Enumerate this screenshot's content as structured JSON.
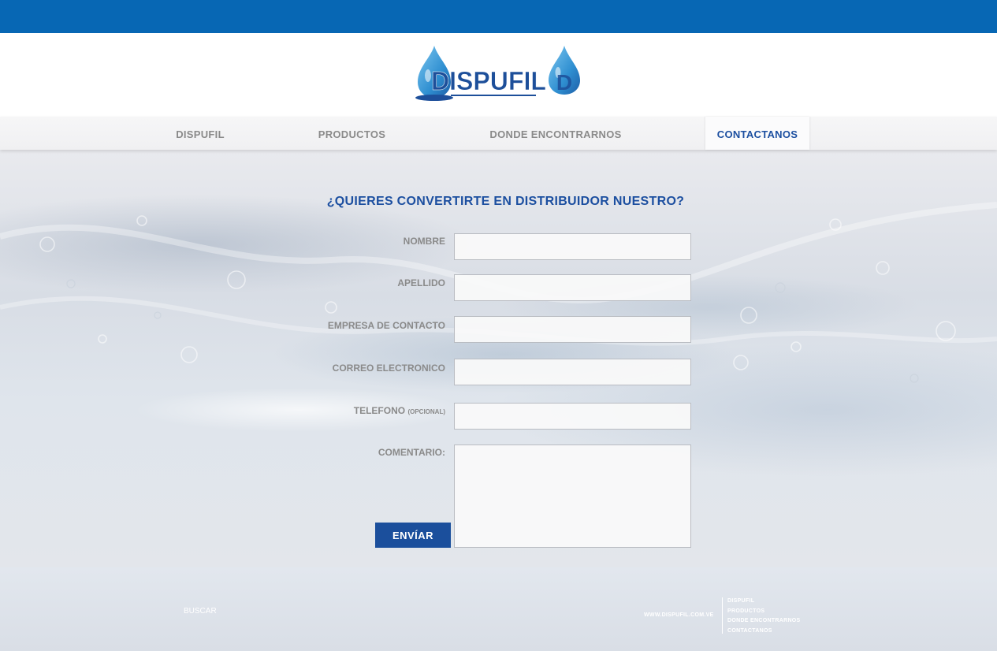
{
  "colors": {
    "top_bar": "#0767b4",
    "brand_blue": "#1c4fa0",
    "nav_text": "#8a8a8a",
    "button": "#1b4f9c"
  },
  "header": {
    "logo_text": "DISPUFIL"
  },
  "nav": {
    "items": [
      {
        "label": "DISPUFIL"
      },
      {
        "label": "PRODUCTOS"
      },
      {
        "label": "DONDE ENCONTRARNOS"
      },
      {
        "label": "CONTACTANOS",
        "active": true
      }
    ]
  },
  "form": {
    "title": "¿QUIERES CONVERTIRTE EN DISTRIBUIDOR NUESTRO?",
    "fields": {
      "nombre": {
        "label": "NOMBRE",
        "value": ""
      },
      "apellido": {
        "label": "APELLIDO",
        "value": ""
      },
      "empresa": {
        "label": "EMPRESA DE CONTACTO",
        "value": ""
      },
      "correo": {
        "label": "CORREO ELECTRONICO",
        "value": ""
      },
      "telefono": {
        "label": "TELEFONO",
        "note": "(OPCIONAL)",
        "value": ""
      },
      "comentario": {
        "label": "COMENTARIO:",
        "value": ""
      }
    },
    "submit_label": "ENVÍAR"
  },
  "footer": {
    "search_label": "BUSCAR",
    "url": "WWW.DISPUFIL.COM.VE",
    "links": [
      "DISPUFIL",
      "PRODUCTOS",
      "DONDE ENCONTRARNOS",
      "CONTACTANOS"
    ]
  }
}
